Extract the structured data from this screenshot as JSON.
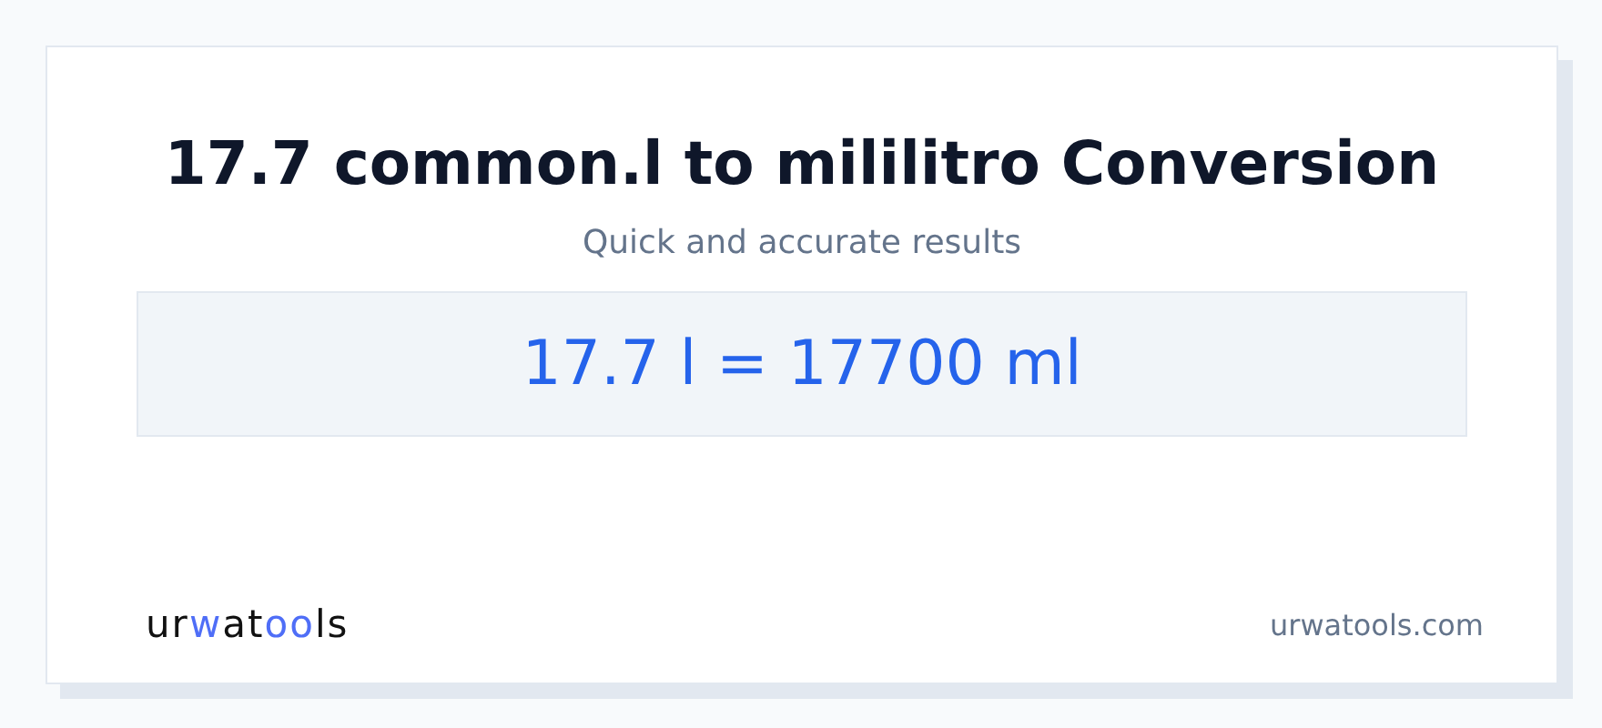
{
  "title": "17.7 common.l to mililitro Conversion",
  "subtitle": "Quick and accurate results",
  "result": "17.7 l = 17700 ml",
  "logo": [
    {
      "text": "ur",
      "accent": false
    },
    {
      "text": "w",
      "accent": true
    },
    {
      "text": "at",
      "accent": false
    },
    {
      "text": "oo",
      "accent": true
    },
    {
      "text": "ls",
      "accent": false
    }
  ],
  "site": "urwatools.com"
}
